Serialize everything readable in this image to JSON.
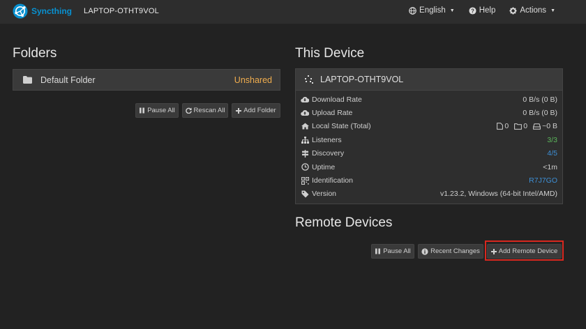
{
  "nav": {
    "brand": "Syncthing",
    "device_name": "LAPTOP-OTHT9VOL",
    "language": "English",
    "help": "Help",
    "actions": "Actions",
    "icons": [
      "globe-icon",
      "question-icon",
      "gear-icon"
    ]
  },
  "folders": {
    "heading": "Folders",
    "items": [
      {
        "label": "Default Folder",
        "status": "Unshared"
      }
    ],
    "buttons": {
      "pause_all": "Pause All",
      "rescan_all": "Rescan All",
      "add_folder": "Add Folder"
    }
  },
  "this_device": {
    "heading": "This Device",
    "name": "LAPTOP-OTHT9VOL",
    "rows": {
      "download_rate": {
        "label": "Download Rate",
        "value": "0 B/s (0 B)"
      },
      "upload_rate": {
        "label": "Upload Rate",
        "value": "0 B/s (0 B)"
      },
      "local_state": {
        "label": "Local State (Total)",
        "files": "0",
        "dirs": "0",
        "size": "~0 B"
      },
      "listeners": {
        "label": "Listeners",
        "value": "3/3"
      },
      "discovery": {
        "label": "Discovery",
        "value": "4/5"
      },
      "uptime": {
        "label": "Uptime",
        "value": "<1m"
      },
      "identification": {
        "label": "Identification",
        "value": "R7J7GO"
      },
      "version": {
        "label": "Version",
        "value": "v1.23.2, Windows (64-bit Intel/AMD)"
      }
    }
  },
  "remote_devices": {
    "heading": "Remote Devices",
    "buttons": {
      "pause_all": "Pause All",
      "recent_changes": "Recent Changes",
      "add_remote_device": "Add Remote Device"
    }
  },
  "colors": {
    "brand": "#0891d1",
    "warning": "#f0ad4e",
    "success": "#5cb85c",
    "info": "#3d8fd6",
    "highlight": "#d9281f"
  }
}
